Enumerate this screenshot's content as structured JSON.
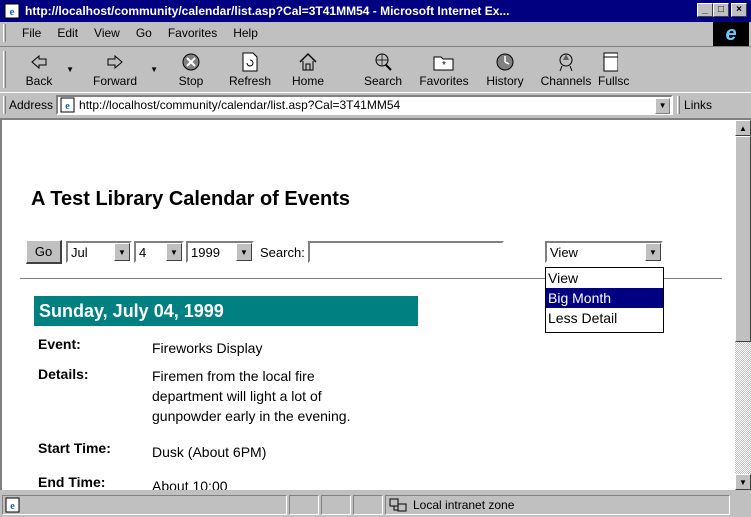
{
  "window": {
    "title": "http://localhost/community/calendar/list.asp?Cal=3T41MM54 - Microsoft Internet Ex...",
    "controls": [
      "_",
      "□",
      "×"
    ]
  },
  "menu": {
    "items": [
      {
        "label": "File"
      },
      {
        "label": "Edit"
      },
      {
        "label": "View"
      },
      {
        "label": "Go"
      },
      {
        "label": "Favorites"
      },
      {
        "label": "Help"
      }
    ]
  },
  "toolbar": {
    "buttons": [
      {
        "label": "Back",
        "icon": "back-arrow-icon"
      },
      {
        "label": "Forward",
        "icon": "forward-arrow-icon"
      },
      {
        "label": "Stop",
        "icon": "stop-icon"
      },
      {
        "label": "Refresh",
        "icon": "refresh-icon"
      },
      {
        "label": "Home",
        "icon": "home-icon"
      },
      {
        "label": "Search",
        "icon": "search-globe-icon"
      },
      {
        "label": "Favorites",
        "icon": "favorites-folder-icon"
      },
      {
        "label": "History",
        "icon": "history-icon"
      },
      {
        "label": "Channels",
        "icon": "channels-icon"
      },
      {
        "label": "Fullsc",
        "icon": "fullscreen-icon"
      }
    ]
  },
  "address": {
    "label": "Address",
    "url": "http://localhost/community/calendar/list.asp?Cal=3T41MM54",
    "links_label": "Links"
  },
  "page": {
    "title": "A Test Library Calendar of Events",
    "go_label": "Go",
    "month": "Jul",
    "day": "4",
    "year": "1999",
    "search_label": "Search:",
    "search_value": "",
    "view": {
      "selected": "View",
      "options": [
        "View",
        "Big Month",
        "Less Detail"
      ],
      "highlighted": "Big Month"
    },
    "date_header": "Sunday, July 04, 1999",
    "event": {
      "event_label": "Event:",
      "event_value": "Fireworks Display",
      "details_label": "Details:",
      "details_lines": [
        "Firemen from the local fire",
        "department will light a lot of",
        "gunpowder early in the evening."
      ],
      "start_label": "Start Time:",
      "start_value": "Dusk (About 6PM)",
      "end_label": "End Time:",
      "end_value": "About 10:00"
    }
  },
  "status": {
    "zone": "Local intranet zone"
  },
  "colors": {
    "titlebar": "#000080",
    "date_header_bg": "#008080",
    "chrome": "#c0c0c0",
    "selection": "#000080"
  }
}
